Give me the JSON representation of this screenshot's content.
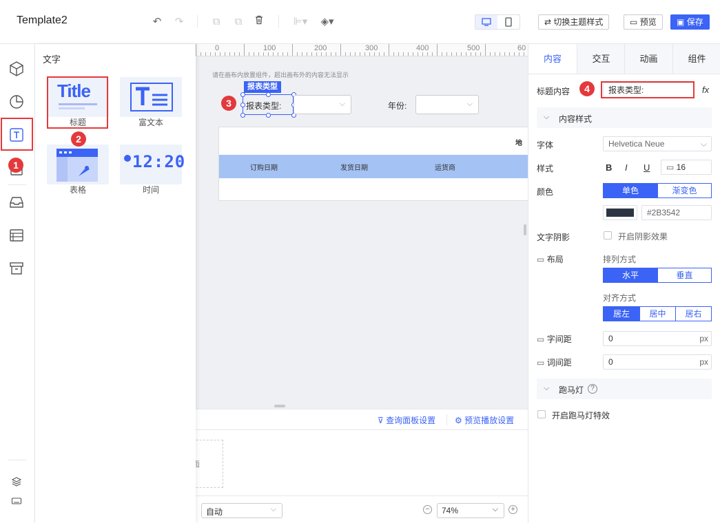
{
  "header": {
    "title": "Template2",
    "switch_theme_label": "切换主题样式",
    "preview_label": "预览",
    "save_label": "保存"
  },
  "panel": {
    "heading": "文字",
    "items": [
      {
        "label": "标题",
        "thumb": "Title"
      },
      {
        "label": "富文本",
        "thumb": "T≡"
      },
      {
        "label": "表格",
        "thumb": ""
      },
      {
        "label": "时间",
        "thumb": "12:20"
      }
    ]
  },
  "canvas": {
    "ruler_numbers": [
      "0",
      "100",
      "200",
      "300",
      "400",
      "500",
      "60"
    ],
    "hint": "请在画布内放置组件，超出画布外的内容无法显示",
    "widget_tag": "报表类型",
    "widget_label": "报表类型:",
    "year_label": "年份:",
    "table_corner": "地",
    "table_headers": [
      "订购日期",
      "发货日期",
      "运货商"
    ],
    "query_panel_link": "查询面板设置",
    "preview_play_link": "预览播放设置",
    "panel_stub_text": "面",
    "auto_select": "自动",
    "zoom": "74%"
  },
  "badges": [
    "1",
    "2",
    "3",
    "4"
  ],
  "right_panel": {
    "tabs": [
      "内容",
      "交互",
      "动画",
      "组件"
    ],
    "title_content_label": "标题内容",
    "title_content_value": "报表类型:",
    "fx_label": "fx",
    "content_style_section": "内容样式",
    "font_label": "字体",
    "font_value": "Helvetica Neue",
    "style_label": "样式",
    "bold": "B",
    "italic": "I",
    "underline": "U",
    "font_size": "16",
    "color_label": "颜色",
    "color_single": "单色",
    "color_gradient": "渐变色",
    "color_hex": "#2B3542",
    "shadow_label": "文字阴影",
    "shadow_option": "开启阴影效果",
    "layout_label": "布局",
    "arrange_label": "排列方式",
    "horizontal": "水平",
    "vertical": "垂直",
    "align_label": "对齐方式",
    "align_left": "居左",
    "align_center": "居中",
    "align_right": "居右",
    "letter_spacing_label": "字间距",
    "letter_spacing_value": "0",
    "word_spacing_label": "词间距",
    "word_spacing_value": "0",
    "unit": "px",
    "marquee_section": "跑马灯",
    "marquee_option": "开启跑马灯特效"
  },
  "colors": {
    "primary": "#3b63f5",
    "text_color_swatch": "#2B3542",
    "badge_red": "#e4393c",
    "table_header": "#a4c2f4"
  }
}
